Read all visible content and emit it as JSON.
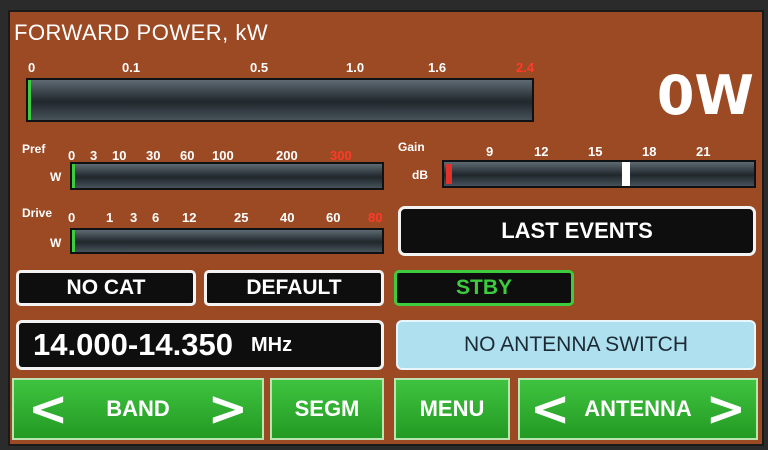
{
  "meter": {
    "title": "FORWARD POWER, kW",
    "ticks": [
      "0",
      "0.1",
      "0.5",
      "1.0",
      "1.6",
      "2.4"
    ],
    "reading": "0W",
    "level": 0
  },
  "pref": {
    "label": "Pref",
    "unit": "W",
    "ticks": [
      "0",
      "3",
      "10",
      "30",
      "60",
      "100",
      "200",
      "300"
    ],
    "level": 0
  },
  "gain": {
    "label": "Gain",
    "unit": "dB",
    "ticks": [
      "9",
      "12",
      "15",
      "18",
      "21"
    ]
  },
  "drive": {
    "label": "Drive",
    "unit": "W",
    "ticks": [
      "0",
      "1",
      "3",
      "6",
      "12",
      "25",
      "40",
      "60",
      "80"
    ],
    "level": 0
  },
  "buttons": {
    "last_events": "LAST EVENTS",
    "no_cat": "NO CAT",
    "default": "DEFAULT",
    "stby": "STBY",
    "band_range": "14.000-14.350",
    "band_unit": "MHz",
    "antenna_switch": "NO ANTENNA SWITCH",
    "band": "BAND",
    "segm": "SEGM",
    "menu": "MENU",
    "antenna": "ANTENNA"
  },
  "colors": {
    "background": "#9c4a24",
    "accent_green": "#3dcc3d",
    "alert_red": "#ff3a2a",
    "info_blue": "#aee0f0"
  },
  "icons": {
    "prev": "chevron-left-icon",
    "next": "chevron-right-icon"
  }
}
